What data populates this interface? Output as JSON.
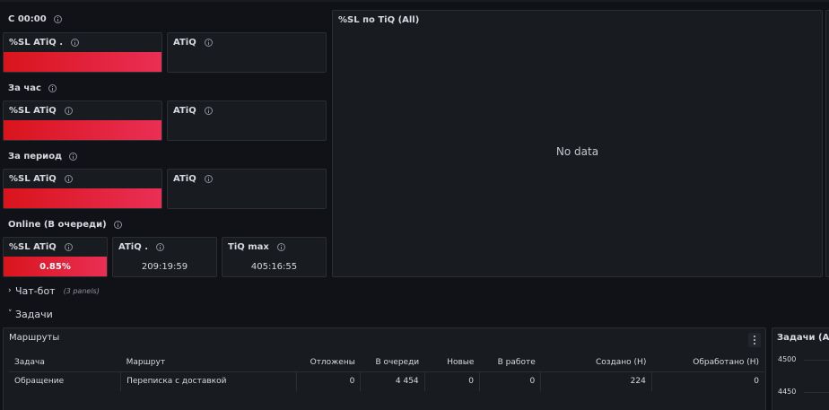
{
  "sections": {
    "s1_label": "С 00:00",
    "s2_label": "За час",
    "s3_label": "За период",
    "s4_label": "Online (В очереди)"
  },
  "panels": {
    "sl_atiq_dot": "%SL ATiQ .",
    "sl_atiq": "%SL ATiQ",
    "atiq": "ATiQ",
    "atiq_dot": "ATiQ .",
    "tiq_max": "TiQ max"
  },
  "online": {
    "sl_value": "0.85%",
    "atiq_value": "209:19:59",
    "tiq_max_value": "405:16:55"
  },
  "chart_panel": {
    "title": "%SL по TiQ (All)",
    "no_data": "No data"
  },
  "rows": {
    "chatbot_title": "Чат-бот",
    "chatbot_count": "(3 panels)",
    "tasks_title": "Задачи"
  },
  "routes_panel": {
    "title": "Маршруты",
    "columns": [
      "Задача",
      "Маршрут",
      "Отложены",
      "В очереди",
      "Новые",
      "В работе",
      "Создано (Н)",
      "Обработано (Н)"
    ],
    "rows": [
      [
        "Обращение",
        "Переписка с доставкой",
        "0",
        "4 454",
        "0",
        "0",
        "224",
        "0"
      ]
    ]
  },
  "tasks_chart": {
    "title": "Задачи (All)",
    "y_ticks": [
      "4500",
      "4450"
    ]
  },
  "colors": {
    "bg": "#111217",
    "panel": "#181b1f",
    "red_start": "#d9141c",
    "red_end": "#ea2f55"
  }
}
